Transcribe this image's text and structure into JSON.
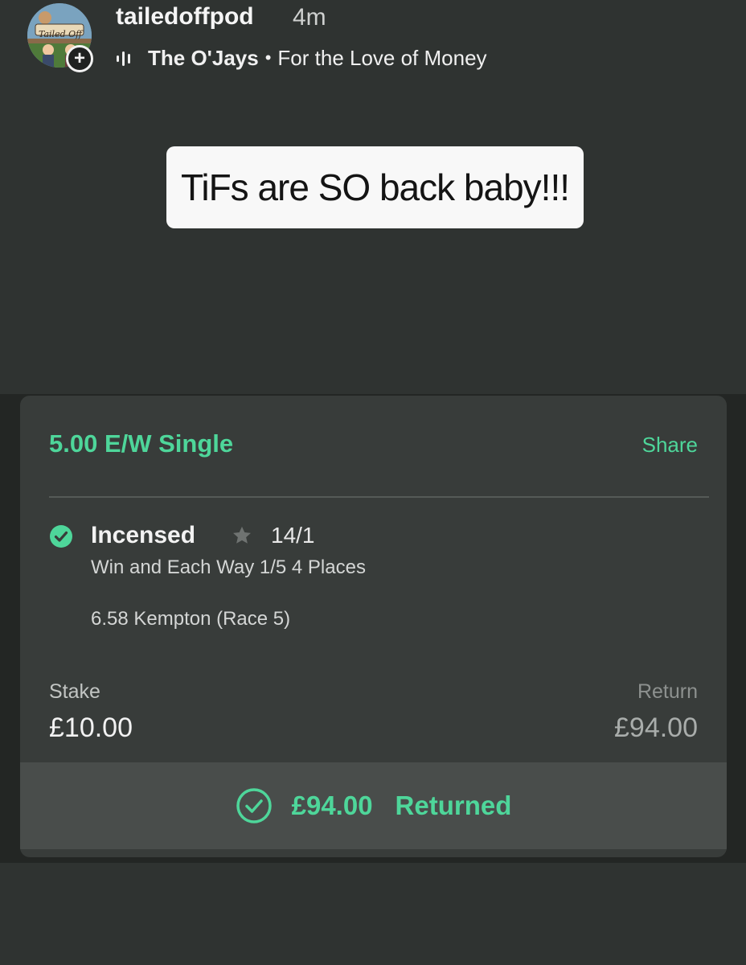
{
  "story": {
    "username": "tailedoffpod",
    "timestamp": "4m",
    "avatar_text": "Tailed Off",
    "music": {
      "artist": "The O'Jays",
      "separator": "•",
      "song": "For the Love of Money"
    }
  },
  "caption": "TiFs are SO back baby!!!",
  "bet": {
    "type": "5.00 E/W Single",
    "share_label": "Share",
    "selection": {
      "name": "Incensed",
      "odds": "14/1",
      "market": "Win and Each Way 1/5 4 Places",
      "race": "6.58 Kempton (Race 5)"
    },
    "stake_label": "Stake",
    "stake_value": "£10.00",
    "return_label": "Return",
    "return_value": "£94.00",
    "returned_amount": "£94.00",
    "returned_label": "Returned"
  },
  "colors": {
    "accent_green": "#4ed69a",
    "background": "#2f3331",
    "card": "#383c3a"
  },
  "icons": {
    "add": "plus-icon",
    "music": "audio-bars-icon",
    "settled": "check-circle-icon",
    "favourite": "star-icon"
  }
}
